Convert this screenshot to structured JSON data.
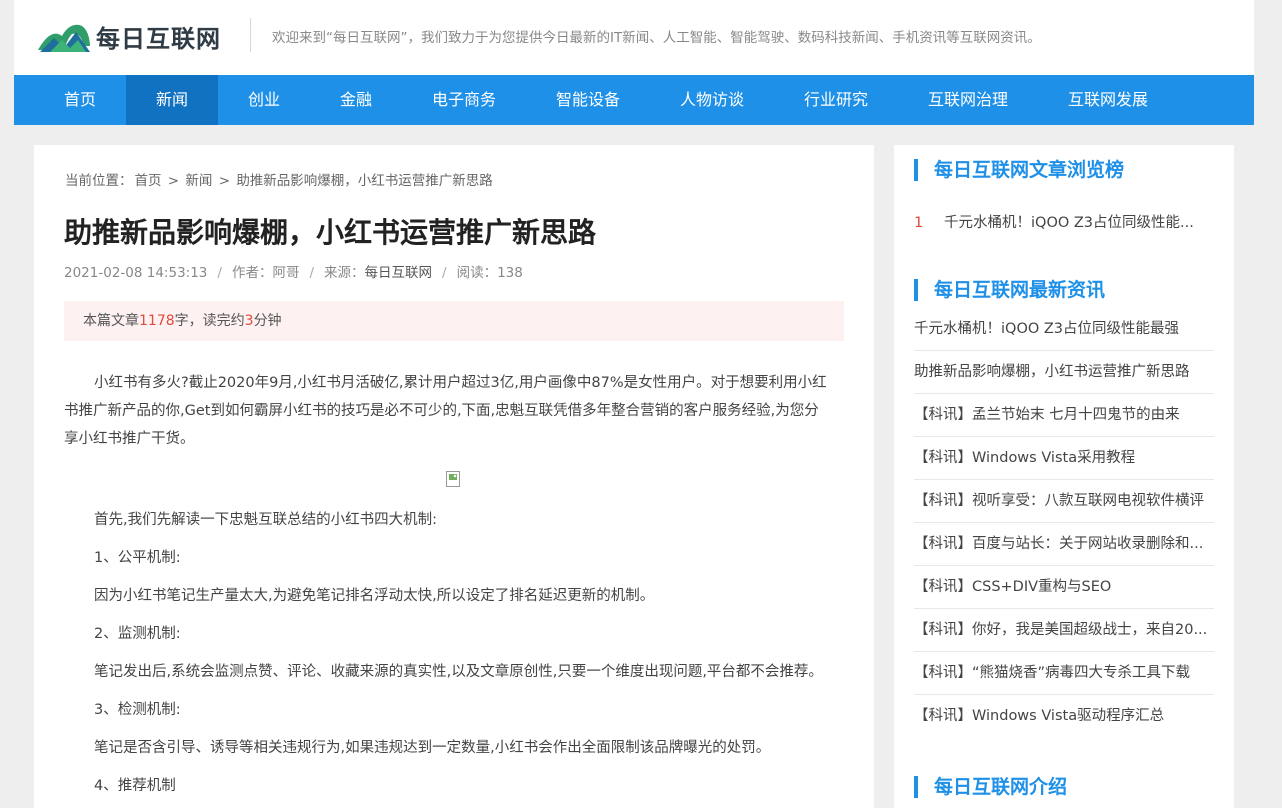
{
  "header": {
    "logo_text": "每日互联网",
    "welcome": "欢迎来到“每日互联网”，我们致力于为您提供今日最新的IT新闻、人工智能、智能驾驶、数码科技新闻、手机资讯等互联网资讯。"
  },
  "nav": {
    "items": [
      {
        "label": "首页"
      },
      {
        "label": "新闻"
      },
      {
        "label": "创业"
      },
      {
        "label": "金融"
      },
      {
        "label": "电子商务"
      },
      {
        "label": "智能设备"
      },
      {
        "label": "人物访谈"
      },
      {
        "label": "行业研究"
      },
      {
        "label": "互联网治理"
      },
      {
        "label": "互联网发展"
      }
    ],
    "active": "新闻"
  },
  "breadcrumb": {
    "prefix": "当前位置：",
    "home": "首页",
    "sep": ">",
    "section": "新闻",
    "current": "助推新品影响爆棚，小红书运营推广新思路"
  },
  "article": {
    "title": "助推新品影响爆棚，小红书运营推广新思路",
    "date": "2021-02-08 14:53:13",
    "meta_sep": "/",
    "author": "作者：阿哥",
    "source_label": "来源：",
    "source": "每日互联网",
    "reads": "阅读：138",
    "notice_prefix": "本篇文章",
    "word_count": "1178",
    "notice_middle": "字，读完约",
    "minutes": "3",
    "notice_suffix": "分钟",
    "intro_lines": [
      "小红书有多火?截止2020年9月,小红书月活破亿,累计用户超过3亿,用户画像中87%是女性用户。对于想要利用小红",
      "书推广新产品的你,Get到如何霸屏小红书的技巧是必不可少的,下面,忠魁互联凭借多年整合营销的客户服务经验,为您分",
      "享小红书推广干货。"
    ],
    "lines": [
      "首先,我们先解读一下忠魁互联总结的小红书四大机制:",
      "1、公平机制:",
      "因为小红书笔记生产量太大,为避免笔记排名浮动太快,所以设定了排名延迟更新的机制。",
      "2、监测机制:",
      "笔记发出后,系统会监测点赞、评论、收藏来源的真实性,以及文章原创性,只要一个维度出现问题,平台都不会推荐。",
      "3、检测机制:",
      "笔记是否含引导、诱导等相关违规行为,如果违规达到一定数量,小红书会作出全面限制该品牌曝光的处罚。",
      "4、推荐机制"
    ]
  },
  "sidebar": {
    "ranking_title": "每日互联网文章浏览榜",
    "ranking": [
      {
        "num": "1",
        "text": "千元水桶机！iQOO Z3占位同级性能..."
      }
    ],
    "latest_title": "每日互联网最新资讯",
    "latest": [
      "千元水桶机！iQOO Z3占位同级性能最强",
      "助推新品影响爆棚，小红书运营推广新思路",
      "【科讯】孟兰节始末 七月十四鬼节的由来",
      "【科讯】Windows Vista采用教程",
      "【科讯】视听享受：八款互联网电视软件横评",
      "【科讯】百度与站长：关于网站收录删除和...",
      "【科讯】CSS+DIV重构与SEO",
      "【科讯】你好，我是美国超级战士，来自20...",
      "【科讯】“熊猫烧香”病毒四大专杀工具下载",
      "【科讯】Windows Vista驱动程序汇总"
    ],
    "intro_title": "每日互联网介绍"
  }
}
